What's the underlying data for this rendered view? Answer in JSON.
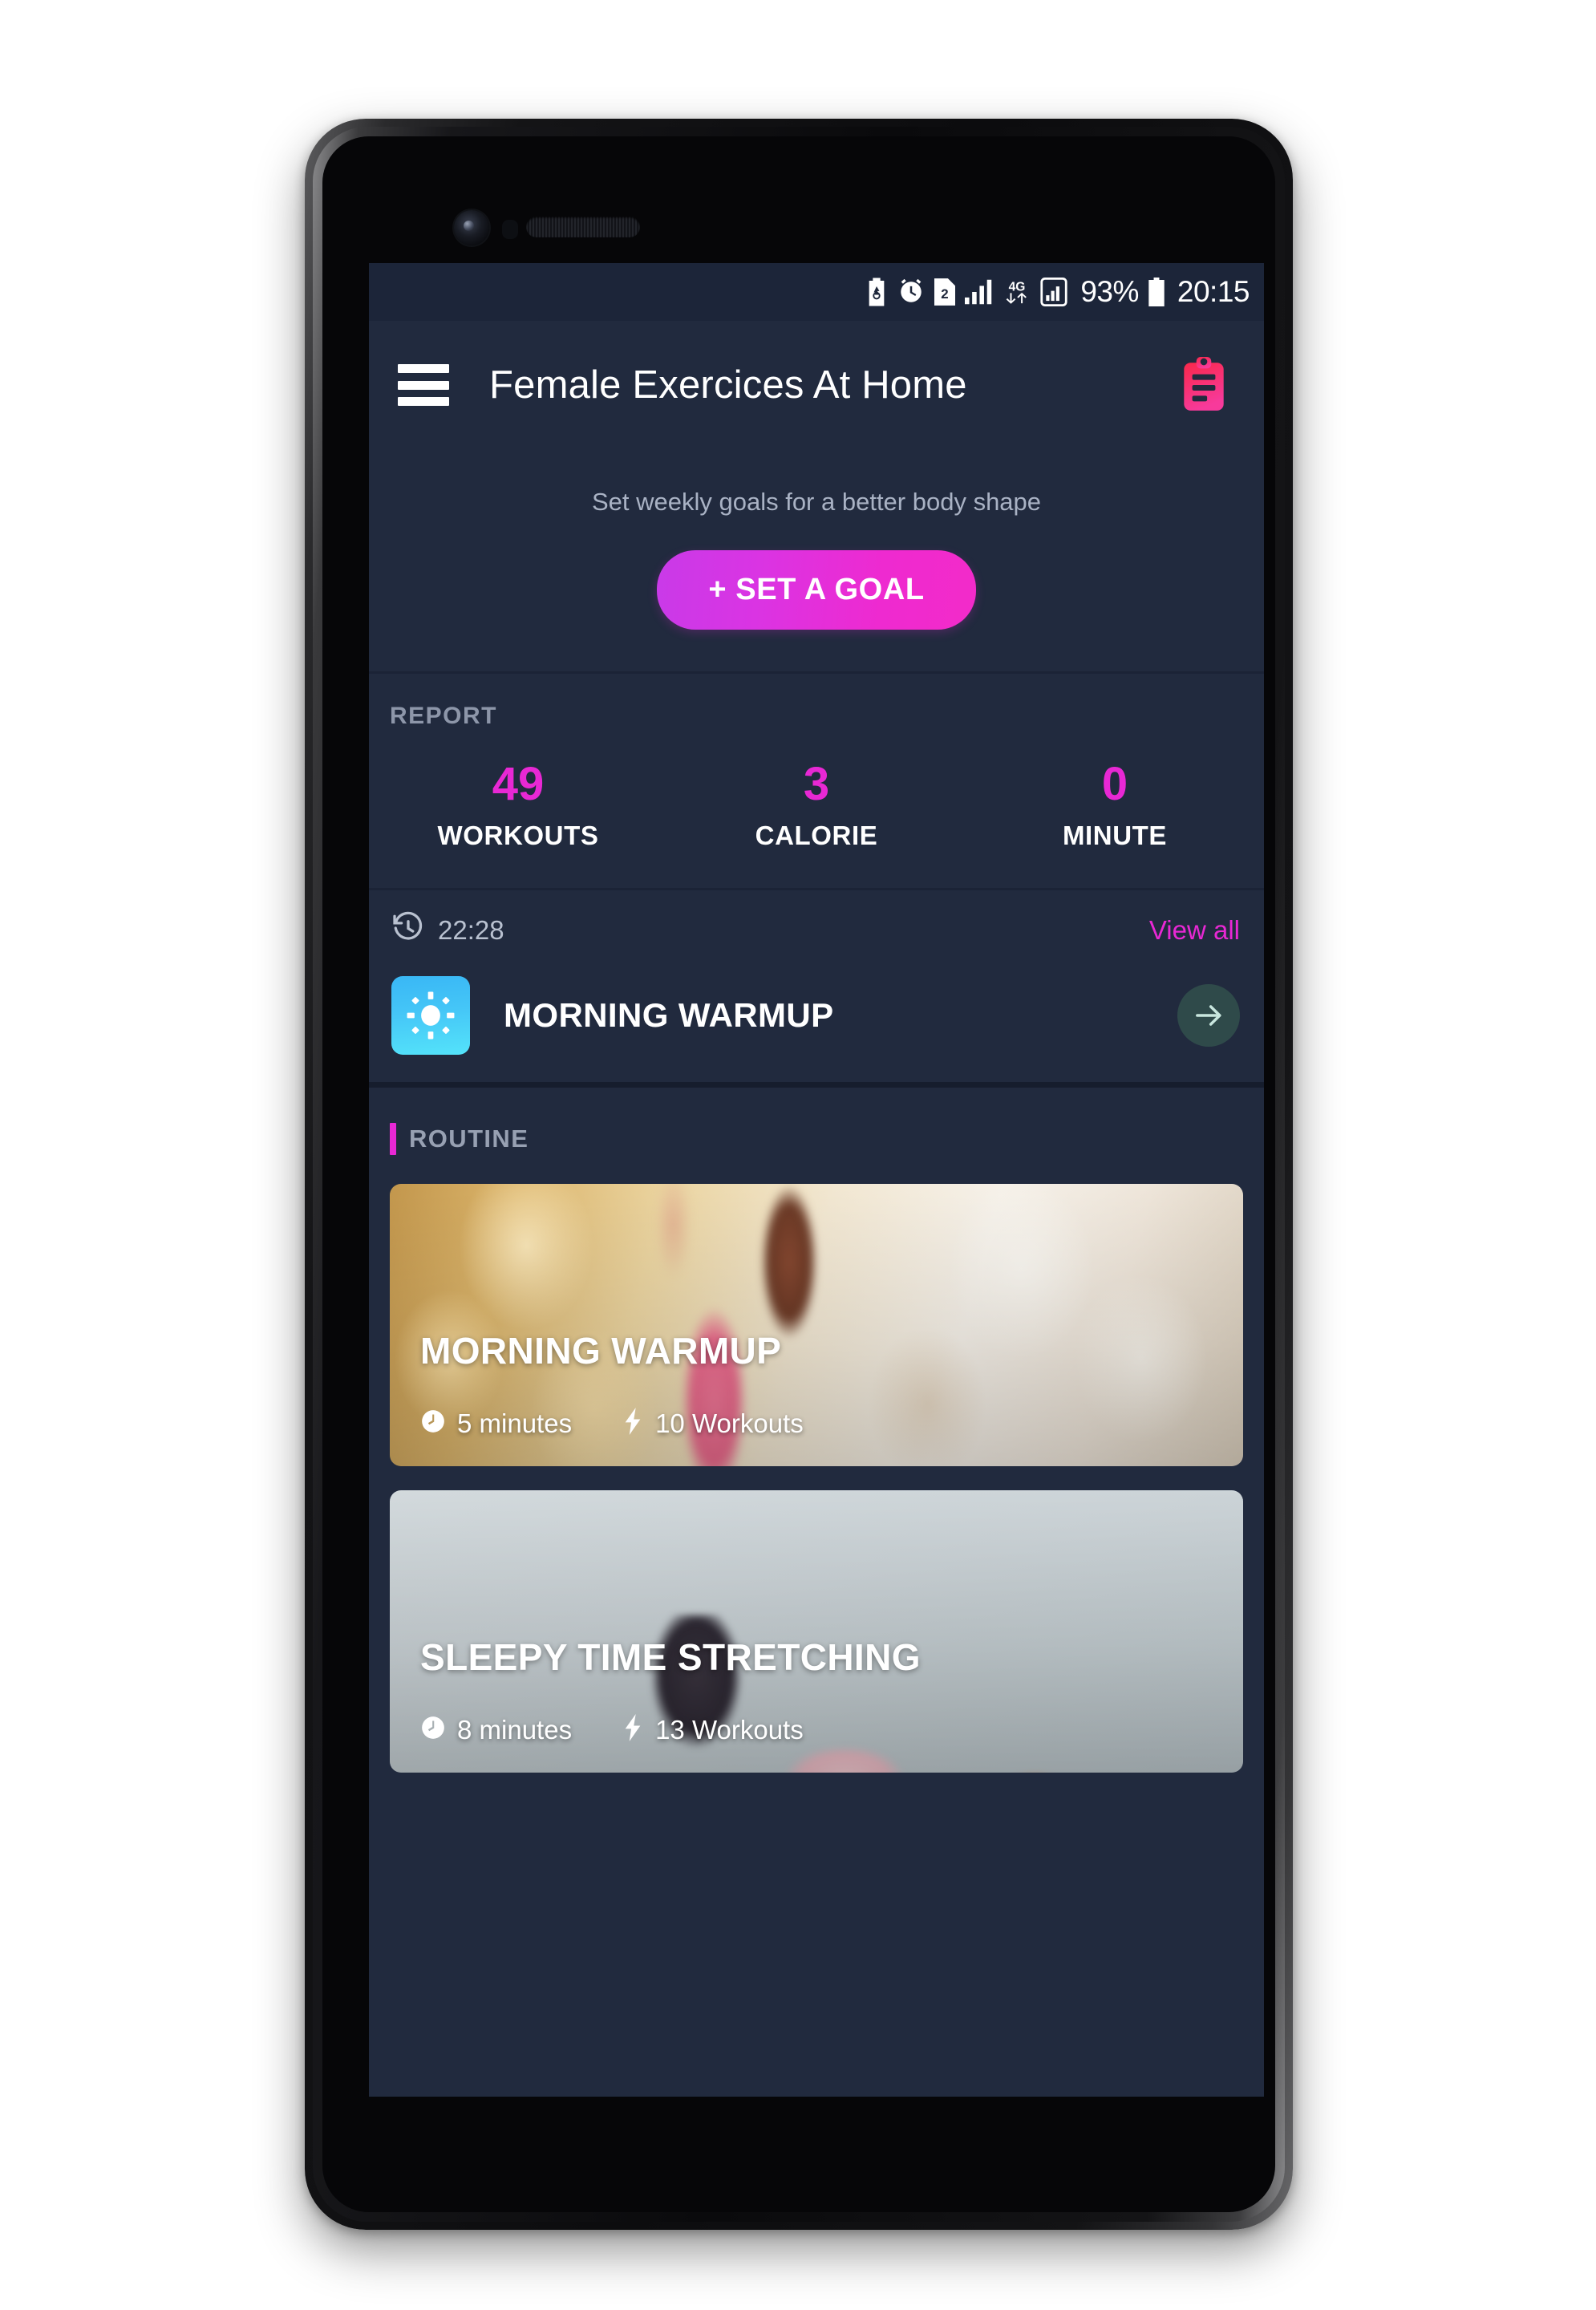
{
  "status_bar": {
    "icons": [
      "battery-saver-icon",
      "alarm-icon",
      "sim2-icon",
      "signal-bars-icon",
      "4g-data-icon",
      "signal-secondary-icon"
    ],
    "network_label": "4G",
    "sim_label": "2",
    "battery_percent": "93%",
    "clock": "20:15"
  },
  "app_bar": {
    "menu_icon": "hamburger-menu-icon",
    "title": "Female Exercices At Home",
    "report_icon": "clipboard-icon"
  },
  "goal": {
    "subtitle": "Set weekly goals for a better body shape",
    "button_label": "+ SET A GOAL"
  },
  "report": {
    "section_label": "REPORT",
    "stats": [
      {
        "value": "49",
        "label": "WORKOUTS"
      },
      {
        "value": "3",
        "label": "CALORIE"
      },
      {
        "value": "0",
        "label": "MINUTE"
      }
    ]
  },
  "history": {
    "history_icon": "history-clock-icon",
    "time": "22:28",
    "view_all_label": "View all",
    "item": {
      "thumb_icon": "sun-icon",
      "title": "MORNING WARMUP",
      "go_icon": "arrow-right-icon"
    }
  },
  "routine": {
    "section_label": "ROUTINE",
    "cards": [
      {
        "title": "MORNING WARMUP",
        "duration_icon": "clock-icon",
        "duration": "5 minutes",
        "workouts_icon": "bolt-icon",
        "workouts": "10 Workouts"
      },
      {
        "title": "SLEEPY TIME STRETCHING",
        "duration_icon": "clock-icon",
        "duration": "8 minutes",
        "workouts_icon": "bolt-icon",
        "workouts": "13 Workouts"
      }
    ]
  },
  "colors": {
    "background": "#212a3e",
    "accent_magenta": "#e828d4",
    "status_bar_bg": "#1c2539",
    "text_primary": "#ffffff",
    "text_muted": "#a9b2c4",
    "thumb_blue": "#45c6f7",
    "go_button_teal": "#2f4a4a",
    "clipboard_red": "#f5365c"
  }
}
